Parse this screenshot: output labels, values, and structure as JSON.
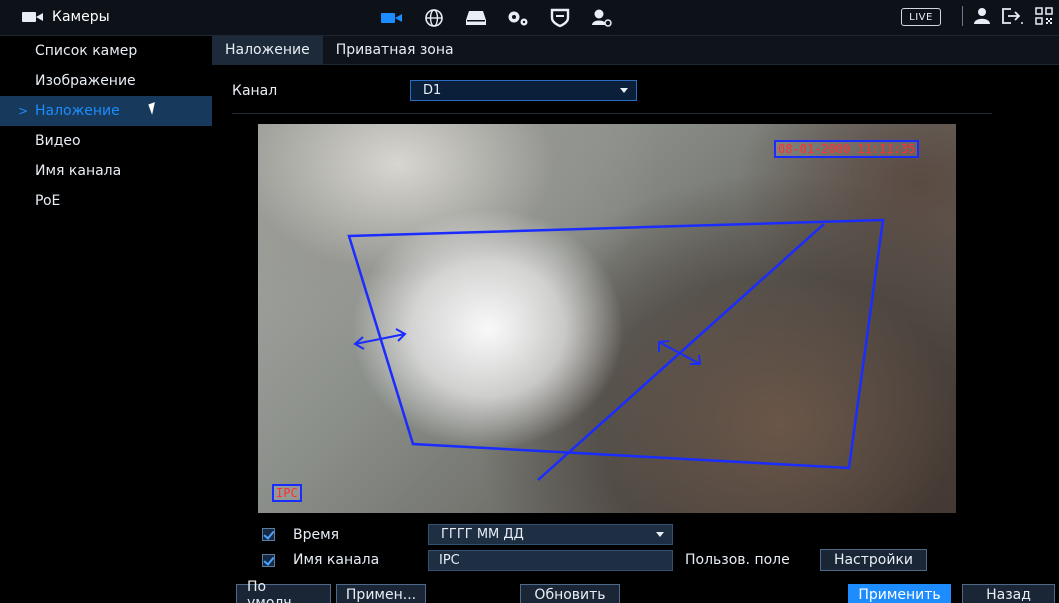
{
  "topbar": {
    "title": "Камеры",
    "live_label": "LIVE",
    "icons": [
      "camera-icon",
      "network-icon",
      "storage-icon",
      "system-settings-icon",
      "security-icon",
      "account-icon"
    ]
  },
  "sidebar": {
    "items": [
      {
        "label": "Список камер",
        "active": false
      },
      {
        "label": "Изображение",
        "active": false
      },
      {
        "label": "Наложение",
        "active": true
      },
      {
        "label": "Видео",
        "active": false
      },
      {
        "label": "Имя канала",
        "active": false
      },
      {
        "label": "PoE",
        "active": false
      }
    ],
    "active_marker": ">"
  },
  "tabs": [
    {
      "label": "Наложение",
      "active": true
    },
    {
      "label": "Приватная зона",
      "active": false
    }
  ],
  "channel": {
    "label": "Канал",
    "value": "D1"
  },
  "video": {
    "timestamp": "08-01-2000 11:11:35",
    "channel_name_overlay": "IPC"
  },
  "options": {
    "time": {
      "label": "Время",
      "checked": true,
      "format": "ГГГГ ММ ДД"
    },
    "channel_name": {
      "label": "Имя канала",
      "checked": true,
      "value": "IPC"
    },
    "custom_field_label": "Пользов. поле",
    "settings_button": "Настройки"
  },
  "footer": {
    "default_button": "По умолч...",
    "apply_to_button": "Примен...",
    "refresh_button": "Обновить",
    "apply_button": "Применить",
    "back_button": "Назад"
  },
  "colors": {
    "accent": "#1c8cff",
    "overlay_border": "#1a2cff",
    "overlay_text": "#ff3030"
  }
}
